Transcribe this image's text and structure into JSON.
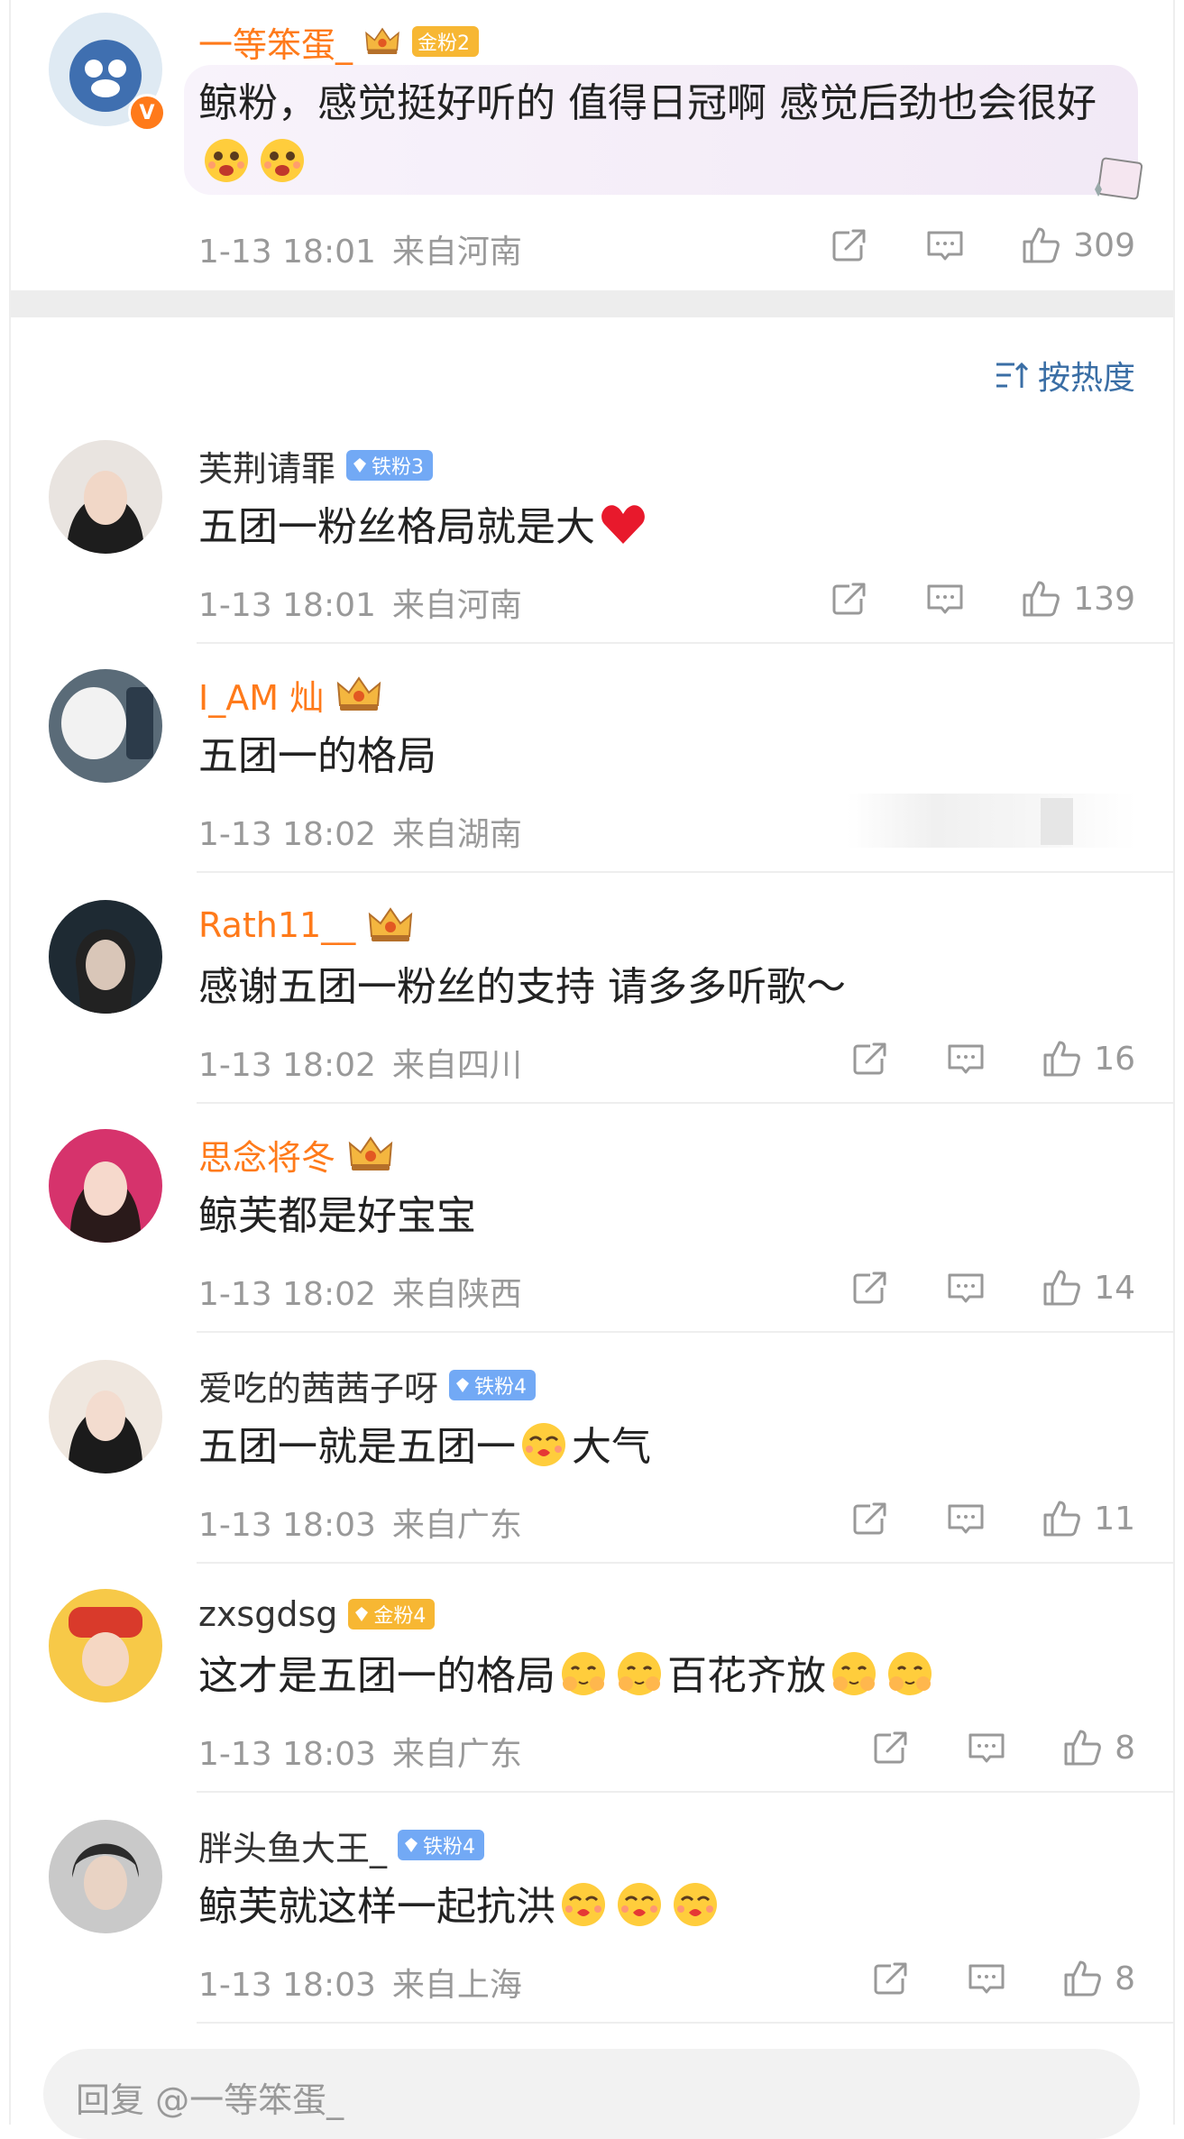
{
  "reply_placeholder": "回复 @一等笨蛋_",
  "sort_label": "按热度",
  "comments": [
    {
      "user": "一等笨蛋_",
      "badge": "金粉2",
      "text": "鲸粉，感觉挺好听的 值得日冠啊 感觉后劲也会很好",
      "date": "1-13 18:01",
      "location": "来自河南",
      "likes": "309",
      "verified": "V"
    },
    {
      "user": "芙荆请罪",
      "badge": "铁粉3",
      "text": "五团一粉丝格局就是大",
      "date": "1-13 18:01",
      "location": "来自河南",
      "likes": "139"
    },
    {
      "user": "I_AM 灿",
      "text": "五团一的格局",
      "date": "1-13 18:02",
      "location": "来自湖南"
    },
    {
      "user": "Rath11__",
      "text": "感谢五团一粉丝的支持 请多多听歌～",
      "date": "1-13 18:02",
      "location": "来自四川",
      "likes": "16"
    },
    {
      "user": "思念将冬",
      "text": "鲸芙都是好宝宝",
      "date": "1-13 18:02",
      "location": "来自陕西",
      "likes": "14"
    },
    {
      "user": "爱吃的茜茜子呀",
      "badge": "铁粉4",
      "text_a": "五团一就是五团一",
      "text_b": "大气",
      "date": "1-13 18:03",
      "location": "来自广东",
      "likes": "11"
    },
    {
      "user": "zxsgdsg",
      "badge": "金粉4",
      "text_a": "这才是五团一的格局",
      "text_b": "百花齐放",
      "date": "1-13 18:03",
      "location": "来自广东",
      "likes": "8"
    },
    {
      "user": "胖头鱼大王_",
      "badge": "铁粉4",
      "text": "鲸芙就这样一起抗洪",
      "date": "1-13 18:03",
      "location": "来自上海",
      "likes": "8"
    }
  ],
  "colors": {
    "accent_orange": "#ff7a1a",
    "iron_badge": "#72a9f5",
    "gold_badge": "#f7b733",
    "sort_blue": "#3a6ea5"
  }
}
